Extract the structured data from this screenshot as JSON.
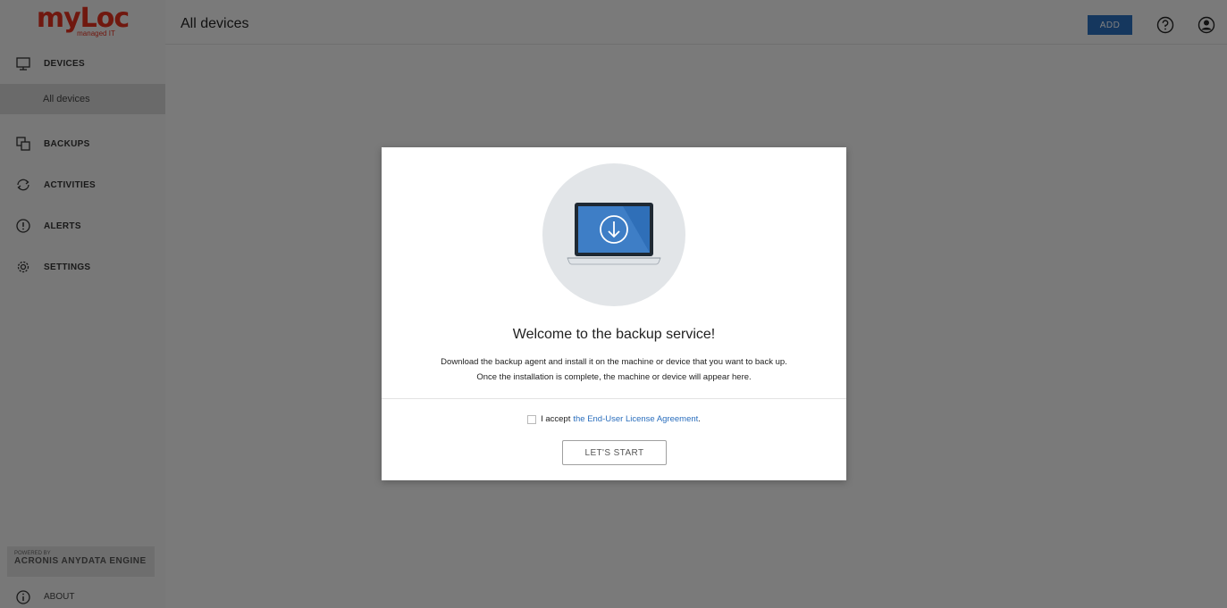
{
  "brand": {
    "logo_text": "myLoc",
    "logo_subtext": "managed IT",
    "accent": "#e0301e"
  },
  "header": {
    "title": "All devices",
    "add_label": "ADD",
    "primary_color": "#2a6ebd"
  },
  "sidebar": {
    "items": [
      {
        "label": "DEVICES",
        "icon": "monitor-icon"
      },
      {
        "label": "All devices",
        "icon": ""
      },
      {
        "label": "BACKUPS",
        "icon": "backups-icon"
      },
      {
        "label": "ACTIVITIES",
        "icon": "activities-icon"
      },
      {
        "label": "ALERTS",
        "icon": "alert-icon"
      },
      {
        "label": "SETTINGS",
        "icon": "gear-icon"
      }
    ],
    "powered_by": "POWERED BY",
    "engine": "ACRONIS ANYDATA ENGINE",
    "about": "ABOUT"
  },
  "modal": {
    "title": "Welcome to the backup service!",
    "desc_line1": "Download the backup agent and install it on the machine or device that you want to back up.",
    "desc_line2": "Once the installation is complete, the machine or device will appear here.",
    "accept_prefix": "I accept",
    "accept_link": "the End-User License Agreement",
    "accept_suffix": ".",
    "checkbox_checked": false,
    "start_label": "LET'S START"
  }
}
